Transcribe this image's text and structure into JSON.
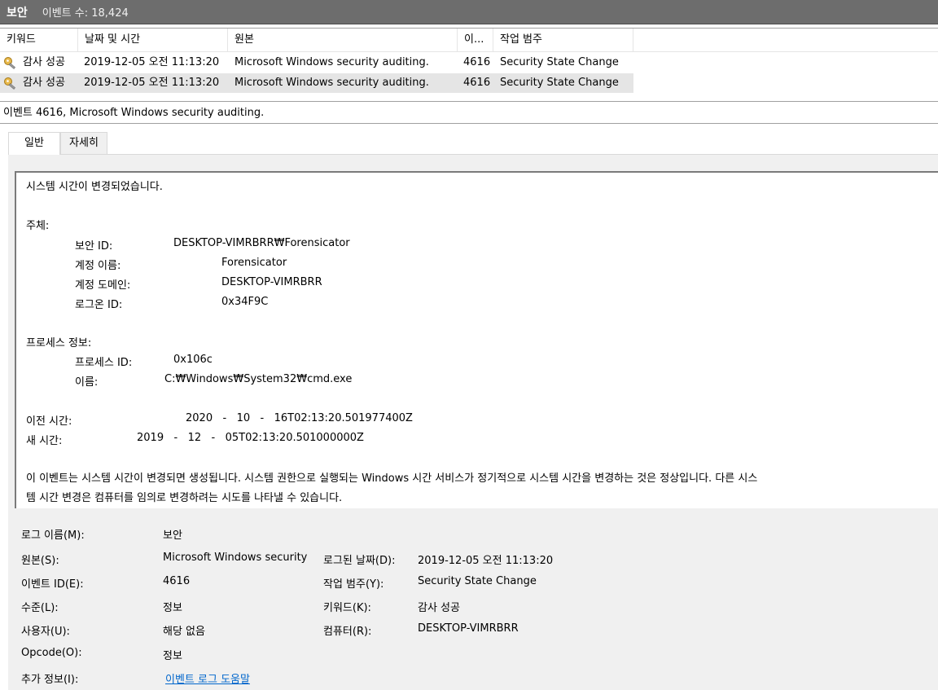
{
  "titlebar": {
    "title": "보안",
    "count": "이벤트 수: 18,424"
  },
  "columns": [
    "키워드",
    "날짜 및 시간",
    "원본",
    "이...",
    "작업 범주"
  ],
  "rows": [
    {
      "keyword": "감사 성공",
      "datetime": "2019-12-05 오전 11:13:20",
      "source": "Microsoft Windows security auditing.",
      "id": "4616",
      "category": "Security State Change",
      "icon": "key-icon"
    },
    {
      "keyword": "감사 성공",
      "datetime": "2019-12-05 오전 11:13:20",
      "source": "Microsoft Windows security auditing.",
      "id": "4616",
      "category": "Security State Change",
      "icon": "key-icon"
    }
  ],
  "event_header": "이벤트 4616, Microsoft Windows security auditing.",
  "tabs": [
    "일반",
    "자세히"
  ],
  "description": {
    "line1": "시스템 시간이 변경되었습니다.",
    "subject_label": "주체:",
    "security_id_label": "보안 ID:",
    "security_id": "DESKTOP-VIMRBRR₩Forensicator",
    "account_name_label": "계정 이름:",
    "account_name": "Forensicator",
    "account_domain_label": "계정 도메인:",
    "account_domain": "DESKTOP-VIMRBRR",
    "logon_id_label": "로그온 ID:",
    "logon_id": "0x34F9C",
    "process_label": "프로세스 정보:",
    "process_id_label": "프로세스 ID:",
    "process_id": "0x106c",
    "name_label": "이름:",
    "name": "C:₩Windows₩System32₩cmd.exe",
    "prev_time_label": "이전 시간:",
    "prev_time": "2020   -   10   -   16T02:13:20.501977400Z",
    "new_time_label": "새 시간:",
    "new_time": "2019   -   12   -   05T02:13:20.501000000Z",
    "footer_line1": "이 이벤트는 시스템 시간이 변경되면 생성됩니다. 시스템 권한으로 실행되는 Windows 시간 서비스가 정기적으로 시스템 시간을 변경하는 것은 정상입니다. 다른 시스",
    "footer_line2": "템 시간 변경은 컴퓨터를 임의로 변경하려는 시도를 나타낼 수 있습니다."
  },
  "properties": {
    "log_name_label": "로그 이름(M):",
    "log_name": "보안",
    "source_label": "원본(S):",
    "source": "Microsoft Windows security",
    "logged_label": "로그된 날짜(D):",
    "logged": "2019-12-05 오전 11:13:20",
    "event_id_label": "이벤트 ID(E):",
    "event_id": "4616",
    "task_label": "작업 범주(Y):",
    "task": "Security State Change",
    "level_label": "수준(L):",
    "level": "정보",
    "keywords_label": "키워드(K):",
    "keywords": "감사 성공",
    "user_label": "사용자(U):",
    "user": "해당 없음",
    "computer_label": "컴퓨터(R):",
    "computer": "DESKTOP-VIMRBRR",
    "opcode_label": "Opcode(O):",
    "opcode": "정보",
    "more_info_label": "추가 정보(I):",
    "more_info_link": "이벤트 로그 도움말"
  }
}
